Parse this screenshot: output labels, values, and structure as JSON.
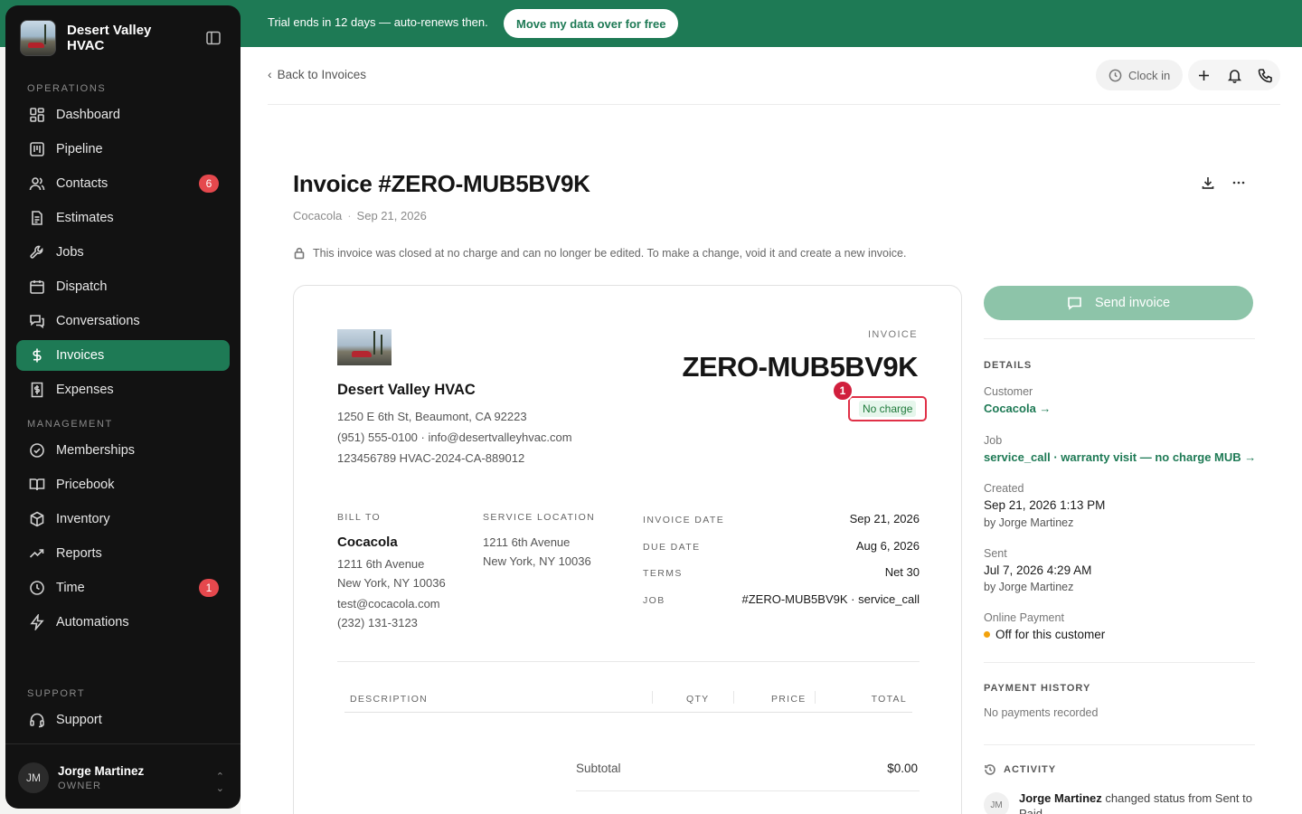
{
  "banner": {
    "text": "Trial ends in 12 days — auto-renews then.",
    "button": "Move my data over for free"
  },
  "sidebar": {
    "brand": "Desert Valley HVAC",
    "sections": {
      "operations": "OPERATIONS",
      "management": "MANAGEMENT",
      "support": "SUPPORT"
    },
    "items": [
      {
        "label": "Dashboard",
        "icon": "dashboard-icon"
      },
      {
        "label": "Pipeline",
        "icon": "pipeline-icon"
      },
      {
        "label": "Contacts",
        "icon": "contacts-icon",
        "badge": "6"
      },
      {
        "label": "Estimates",
        "icon": "estimates-icon"
      },
      {
        "label": "Jobs",
        "icon": "wrench-icon"
      },
      {
        "label": "Dispatch",
        "icon": "calendar-icon"
      },
      {
        "label": "Conversations",
        "icon": "chat-icon"
      },
      {
        "label": "Invoices",
        "icon": "dollar-icon",
        "active": true
      },
      {
        "label": "Expenses",
        "icon": "receipt-icon"
      },
      {
        "label": "Memberships",
        "icon": "badge-check-icon"
      },
      {
        "label": "Pricebook",
        "icon": "book-icon"
      },
      {
        "label": "Inventory",
        "icon": "box-icon"
      },
      {
        "label": "Reports",
        "icon": "trend-icon"
      },
      {
        "label": "Time",
        "icon": "clock-icon",
        "badge": "1"
      },
      {
        "label": "Automations",
        "icon": "bolt-icon"
      },
      {
        "label": "Support",
        "icon": "headset-icon"
      }
    ],
    "user": {
      "initials": "JM",
      "name": "Jorge Martinez",
      "role": "OWNER"
    }
  },
  "topbar": {
    "back": "Back to Invoices",
    "clock_in": "Clock in"
  },
  "header": {
    "title": "Invoice #ZERO-MUB5BV9K",
    "customer": "Cocacola",
    "date": "Sep 21, 2026",
    "lock_note": "This invoice was closed at no charge and can no longer be edited. To make a change, void it and create a new invoice."
  },
  "invoice": {
    "company": "Desert Valley HVAC",
    "address": "1250 E 6th St, Beaumont, CA 92223",
    "contact": "(951) 555-0100 · info@desertvalleyhvac.com",
    "license": "123456789 HVAC-2024-CA-889012",
    "label": "INVOICE",
    "number": "ZERO-MUB5BV9K",
    "status": "No charge",
    "marker": "1",
    "bill_to": {
      "label": "BILL TO",
      "name": "Cocacola",
      "street": "1211 6th Avenue",
      "city": "New York, NY 10036",
      "email": "test@cocacola.com",
      "phone": "(232) 131-3123"
    },
    "service_location": {
      "label": "SERVICE LOCATION",
      "street": "1211 6th Avenue",
      "city": "New York, NY 10036"
    },
    "meta": [
      {
        "key": "INVOICE DATE",
        "value": "Sep 21, 2026"
      },
      {
        "key": "DUE DATE",
        "value": "Aug 6, 2026"
      },
      {
        "key": "TERMS",
        "value": "Net 30"
      },
      {
        "key": "JOB",
        "value": "#ZERO-MUB5BV9K · service_call"
      }
    ],
    "table_headers": {
      "description": "DESCRIPTION",
      "qty": "QTY",
      "price": "PRICE",
      "total": "TOTAL"
    },
    "subtotal_label": "Subtotal",
    "subtotal_value": "$0.00"
  },
  "panel": {
    "send_button": "Send invoice",
    "details_head": "DETAILS",
    "customer_label": "Customer",
    "customer_value": "Cocacola →",
    "job_label": "Job",
    "job_value": "service_call · warranty visit — no charge MUB →",
    "created_label": "Created",
    "created_value": "Sep 21, 2026 1:13 PM",
    "created_by": "by Jorge Martinez",
    "sent_label": "Sent",
    "sent_value": "Jul 7, 2026 4:29 AM",
    "sent_by": "by Jorge Martinez",
    "payment_label": "Online Payment",
    "payment_value": "Off for this customer",
    "payment_history_head": "PAYMENT HISTORY",
    "payment_history_value": "No payments recorded",
    "activity_head": "ACTIVITY",
    "activity": {
      "initials": "JM",
      "actor": "Jorge Martinez",
      "text": "changed status from Sent to Paid"
    }
  }
}
